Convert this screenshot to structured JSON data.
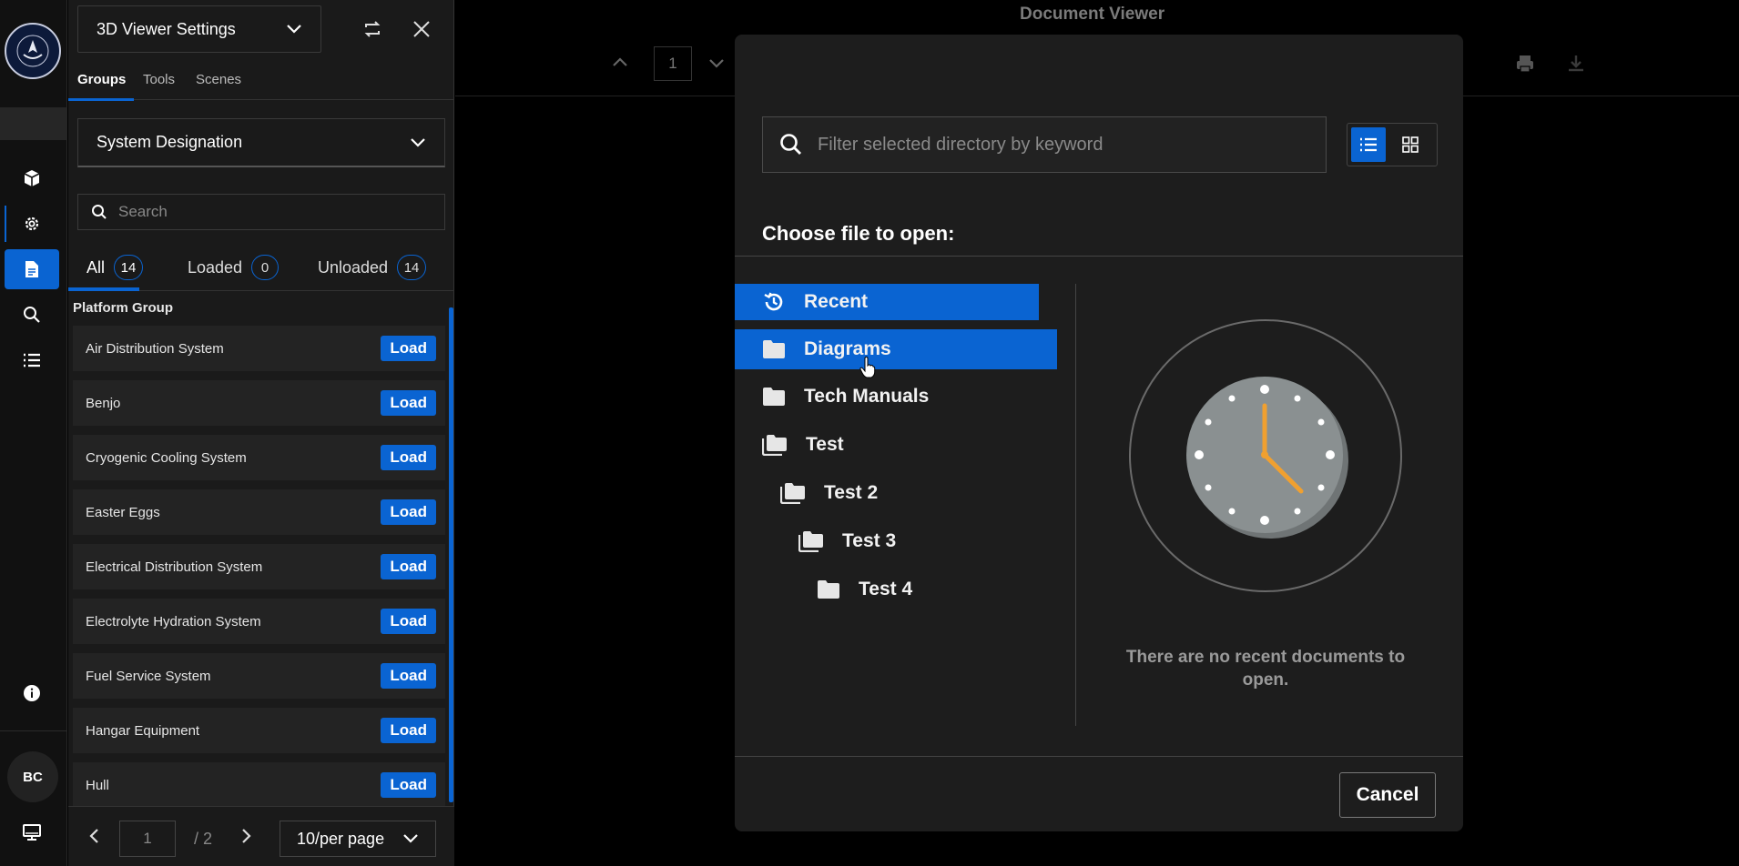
{
  "rail": {
    "avatar_initials": "BC"
  },
  "panel": {
    "settings_title": "3D Viewer Settings",
    "tabs": [
      {
        "label": "Groups"
      },
      {
        "label": "Tools"
      },
      {
        "label": "Scenes"
      }
    ],
    "group_by": "System Designation",
    "search_placeholder": "Search",
    "filters": [
      {
        "label": "All",
        "count": "14"
      },
      {
        "label": "Loaded",
        "count": "0"
      },
      {
        "label": "Unloaded",
        "count": "14"
      }
    ],
    "group_title": "Platform Group",
    "load_label": "Load",
    "items": [
      {
        "name": "Air Distribution System"
      },
      {
        "name": "Benjo"
      },
      {
        "name": "Cryogenic Cooling System"
      },
      {
        "name": "Easter Eggs"
      },
      {
        "name": "Electrical Distribution System"
      },
      {
        "name": "Electrolyte Hydration System"
      },
      {
        "name": "Fuel Service System"
      },
      {
        "name": "Hangar Equipment"
      },
      {
        "name": "Hull"
      }
    ],
    "pager": {
      "current_page": "1",
      "total": "/ 2",
      "per_page": "10/per page"
    }
  },
  "viewer": {
    "title": "Document Viewer",
    "page": "1"
  },
  "modal": {
    "search_placeholder": "Filter selected directory by keyword",
    "choose_label": "Choose file to open:",
    "tree": [
      {
        "label": "Recent",
        "icon": "history-icon"
      },
      {
        "label": "Diagrams",
        "icon": "folder-icon"
      },
      {
        "label": "Tech Manuals",
        "icon": "folder-icon"
      },
      {
        "label": "Test",
        "icon": "folders-icon"
      },
      {
        "label": "Test 2",
        "icon": "folders-icon"
      },
      {
        "label": "Test 3",
        "icon": "folders-icon"
      },
      {
        "label": "Test 4",
        "icon": "folder-icon"
      }
    ],
    "empty_message": "There are no recent documents to open.",
    "cancel_label": "Cancel"
  },
  "colors": {
    "accent": "#0a64d2",
    "panel_bg": "#1a1a1a",
    "modal_bg": "#1d1d1d"
  }
}
